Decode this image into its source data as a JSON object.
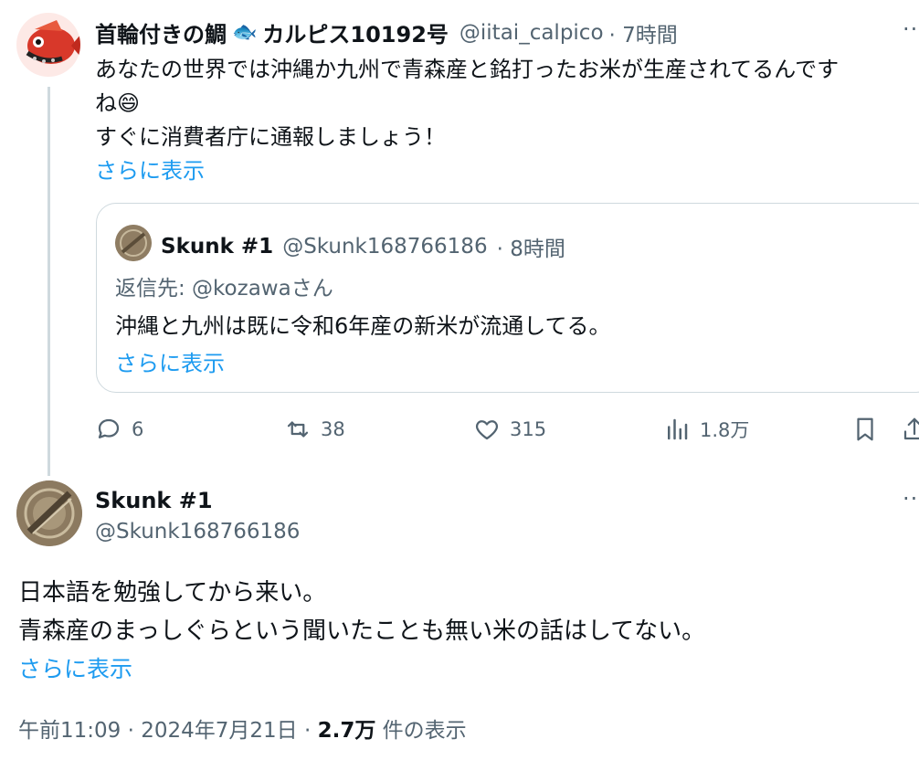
{
  "reply_tweet": {
    "display_name": "首輪付きの鯛",
    "name_emoji": "🐟",
    "display_name_suffix": "カルピス10192号",
    "handle": "@iitai_calpico",
    "time": "· 7時間",
    "line1": "あなたの世界では沖縄か九州で青森産と銘打ったお米が生産されてるんです",
    "line2": "ね😄",
    "line3": "すぐに消費者庁に通報しましょう！",
    "show_more": "さらに表示",
    "more_label": "···"
  },
  "quoted_tweet": {
    "display_name": "Skunk #1",
    "handle": "@Skunk168766186",
    "time": "· 8時間",
    "reply_to": "返信先: @kozawaさん",
    "text": "沖縄と九州は既に令和6年産の新米が流通してる。",
    "show_more": "さらに表示"
  },
  "actions": {
    "replies": "6",
    "retweets": "38",
    "likes": "315",
    "views": "1.8万"
  },
  "main_tweet": {
    "display_name": "Skunk #1",
    "handle": "@Skunk168766186",
    "line1": "日本語を勉強してから来い。",
    "line2": "青森産のまっしぐらという聞いたことも無い米の話はしてない。",
    "show_more": "さらに表示",
    "more_label": "···",
    "timestamp": "午前11:09 · 2024年7月21日 · ",
    "view_count": "2.7万",
    "view_suffix": " 件の表示"
  },
  "colors": {
    "accent": "#1d9bf0",
    "muted": "#536471",
    "text": "#0f1419",
    "border": "#cfd9de"
  }
}
